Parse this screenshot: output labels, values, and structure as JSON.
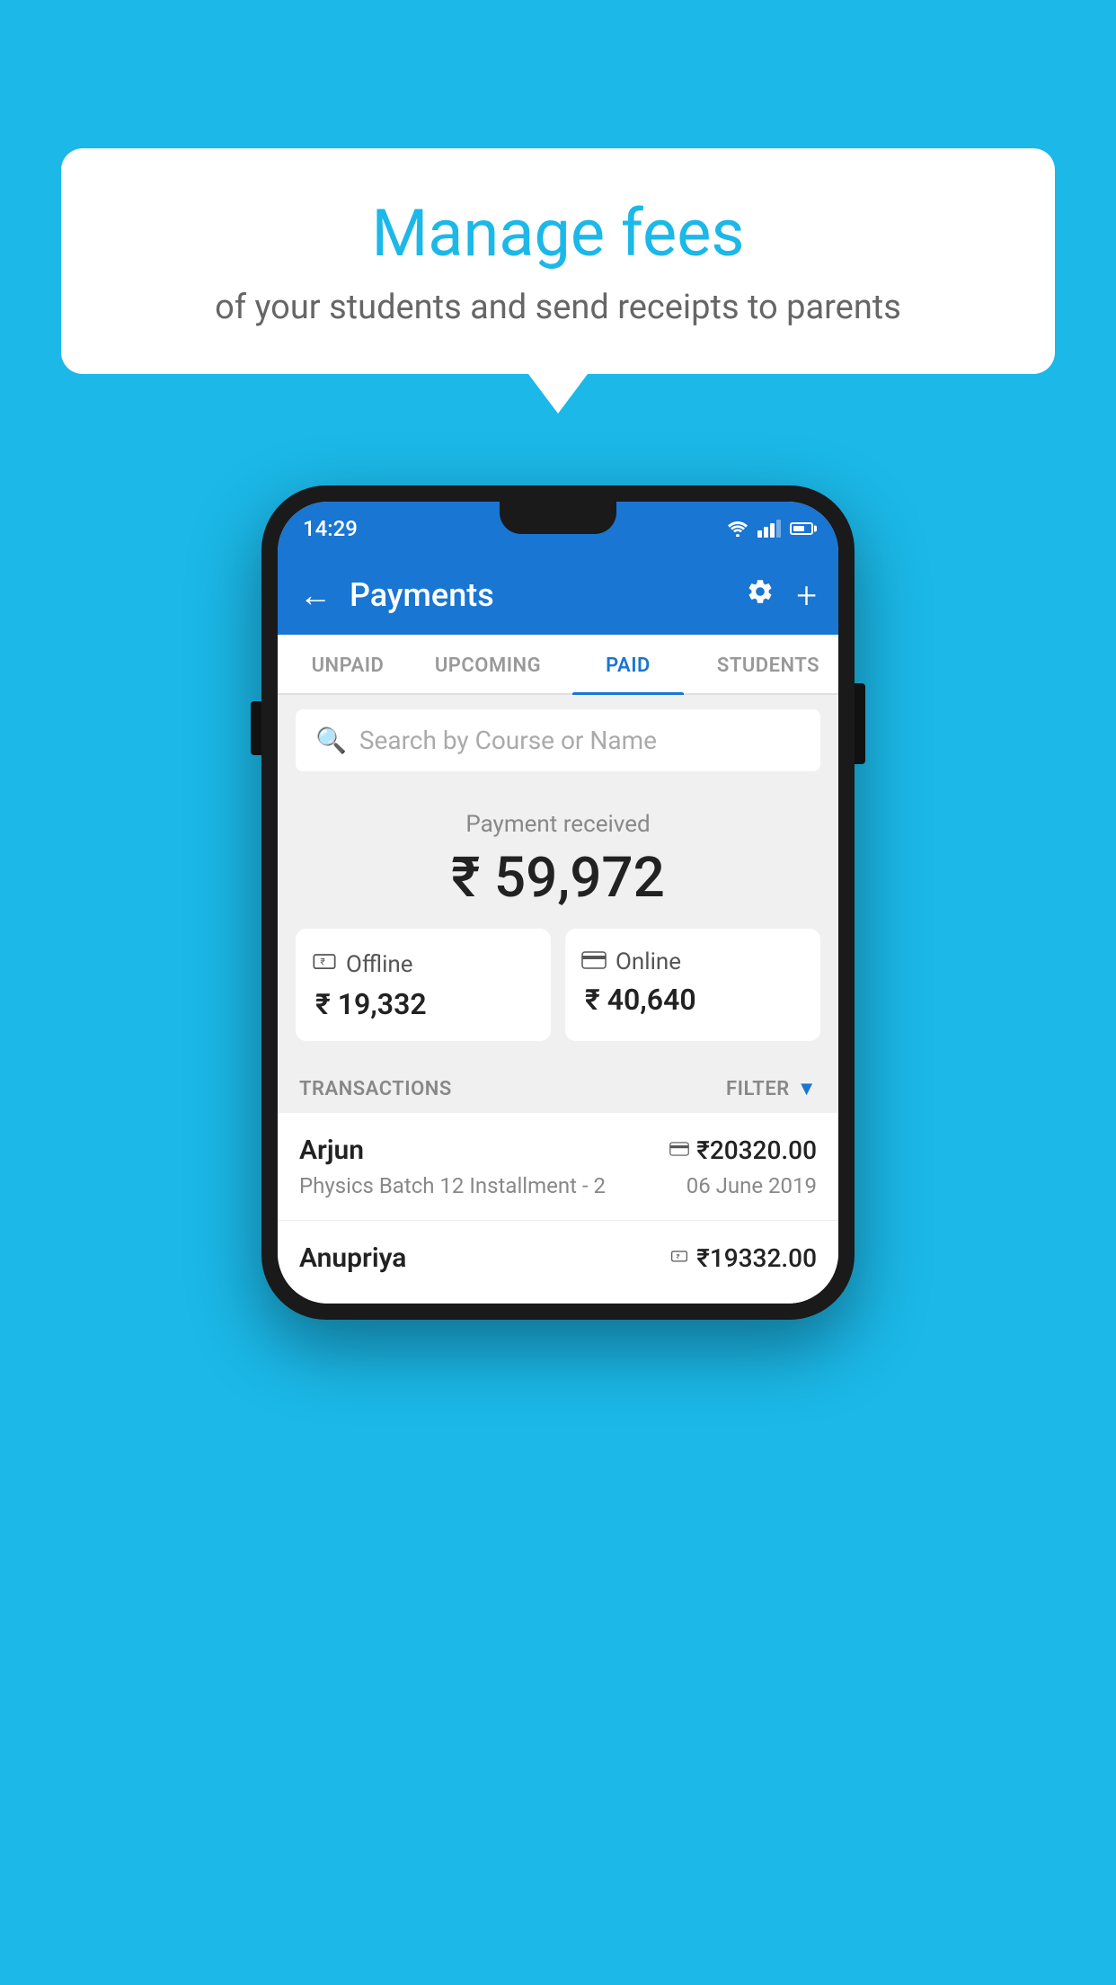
{
  "page": {
    "background_color": "#1bb8e8"
  },
  "speech_bubble": {
    "title": "Manage fees",
    "subtitle": "of your students and send receipts to parents"
  },
  "status_bar": {
    "time": "14:29"
  },
  "app_bar": {
    "title": "Payments",
    "back_icon": "←",
    "settings_icon": "⚙",
    "add_icon": "+"
  },
  "tabs": [
    {
      "label": "UNPAID",
      "active": false
    },
    {
      "label": "UPCOMING",
      "active": false
    },
    {
      "label": "PAID",
      "active": true
    },
    {
      "label": "STUDENTS",
      "active": false
    }
  ],
  "search": {
    "placeholder": "Search by Course or Name"
  },
  "payment_summary": {
    "label": "Payment received",
    "total": "₹ 59,972",
    "offline_label": "Offline",
    "offline_amount": "₹ 19,332",
    "online_label": "Online",
    "online_amount": "₹ 40,640"
  },
  "transactions": {
    "header_label": "TRANSACTIONS",
    "filter_label": "FILTER",
    "items": [
      {
        "name": "Arjun",
        "course": "Physics Batch 12 Installment - 2",
        "amount": "₹20320.00",
        "date": "06 June 2019",
        "type": "online"
      },
      {
        "name": "Anupriya",
        "course": "",
        "amount": "₹19332.00",
        "date": "",
        "type": "offline"
      }
    ]
  }
}
